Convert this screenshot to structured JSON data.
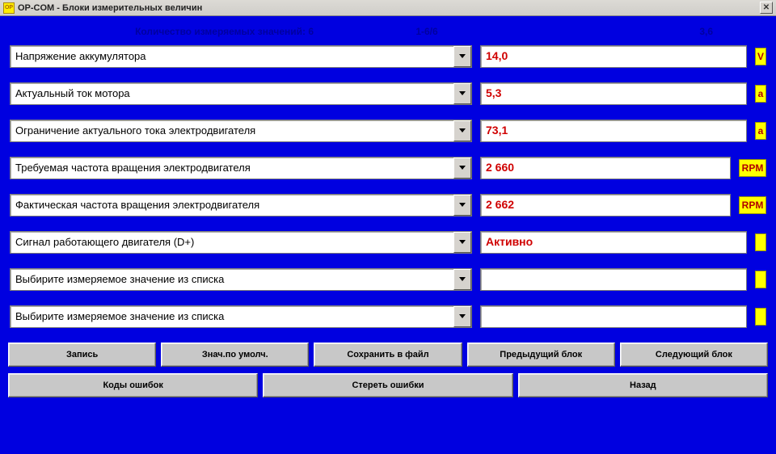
{
  "window": {
    "title": "OP-COM - Блоки измерительных величин"
  },
  "header": {
    "count_label": "Количество измеряемых значений: 6",
    "range": "1-6/6",
    "pace": "3,6"
  },
  "rows": [
    {
      "param": "Напряжение аккумулятора",
      "value": "14,0",
      "unit": "V",
      "unit_short": true
    },
    {
      "param": "Актуальный ток мотора",
      "value": "5,3",
      "unit": "a",
      "unit_short": true
    },
    {
      "param": "Ограничение актуального тока электродвигателя",
      "value": "73,1",
      "unit": "a",
      "unit_short": true
    },
    {
      "param": "Требуемая частота вращения электродвигателя",
      "value": "2 660",
      "unit": "RPM",
      "unit_short": false
    },
    {
      "param": "Фактическая частота вращения электродвигателя",
      "value": "2 662",
      "unit": "RPM",
      "unit_short": false
    },
    {
      "param": "Сигнал работающего двигателя (D+)",
      "value": "Активно",
      "unit": "",
      "unit_short": true
    },
    {
      "param": "Выбирите измеряемое значение из списка",
      "value": "",
      "unit": "",
      "unit_short": true
    },
    {
      "param": "Выбирите измеряемое значение из списка",
      "value": "",
      "unit": "",
      "unit_short": true
    }
  ],
  "buttons1": {
    "record": "Запись",
    "defaults": "Знач.по умолч.",
    "save": "Сохранить в файл",
    "prev": "Предыдущий блок",
    "next": "Следующий блок"
  },
  "buttons2": {
    "codes": "Коды ошибок",
    "clear": "Стереть ошибки",
    "back": "Назад"
  }
}
